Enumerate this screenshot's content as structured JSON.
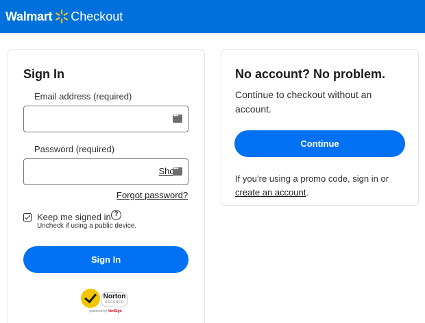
{
  "header": {
    "brand": "Walmart",
    "title": "Checkout",
    "background_color": "#0071dc",
    "spark_color": "#ffc220"
  },
  "signin": {
    "title": "Sign In",
    "email_label": "Email address (required)",
    "email_value": "",
    "password_label": "Password (required)",
    "password_value": "",
    "show_label": "Show",
    "forgot_label": "Forgot password?",
    "keep_signed_in_label": "Keep me signed in",
    "keep_signed_in_checked": true,
    "keep_signed_in_hint": "Uncheck if using a public device.",
    "help_symbol": "?",
    "button_label": "Sign In",
    "badge": {
      "name": "Norton",
      "secured": "SECURED",
      "powered_prefix": "powered by",
      "powered_brand": "VeriSign"
    }
  },
  "guest": {
    "title": "No account? No problem.",
    "description": "Continue to checkout without an account.",
    "button_label": "Continue",
    "promo_text": "If you’re using a promo code, sign in or",
    "create_link": "create an account",
    "promo_end": "."
  },
  "colors": {
    "button_blue": "#0071f3",
    "text_dark": "#1a1a1a"
  }
}
